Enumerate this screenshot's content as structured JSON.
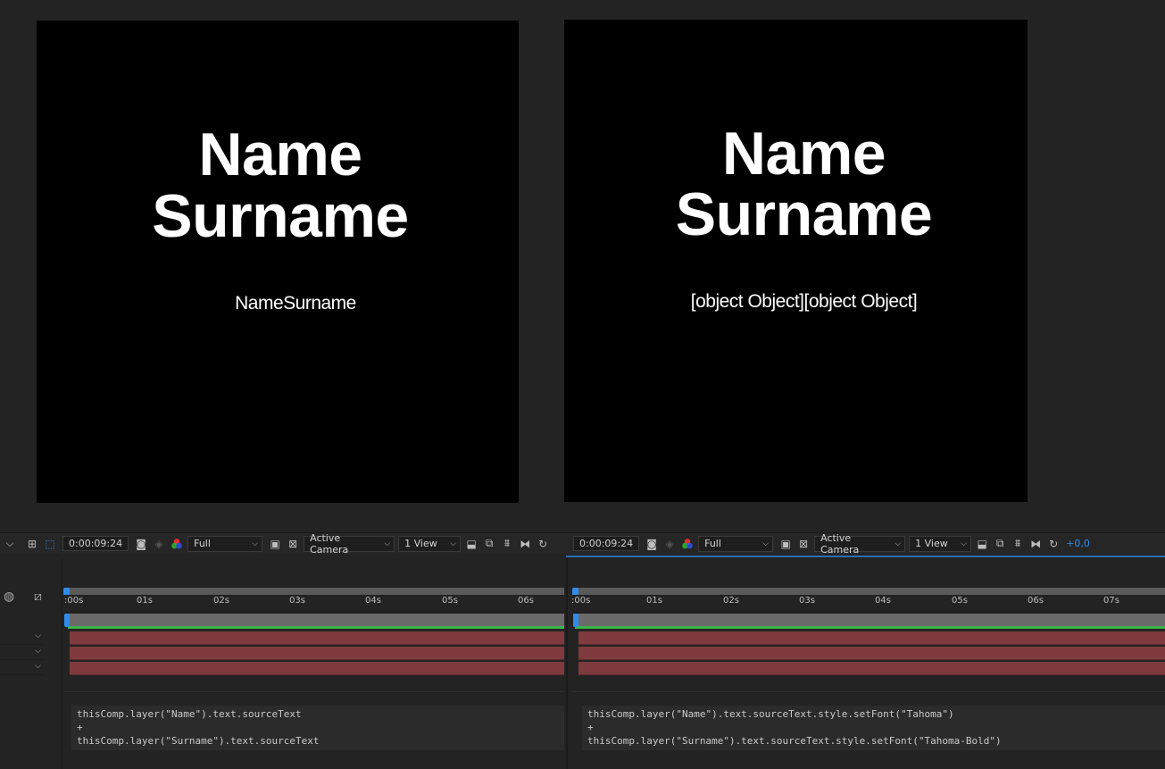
{
  "left_view": {
    "comp_name_line1": "Name",
    "comp_name_line2": "Surname",
    "result_text": "NameSurname",
    "toolbar": {
      "timecode": "0:00:09:24",
      "resolution": "Full",
      "camera": "Active Camera",
      "views": "1 View"
    },
    "ruler_ticks": [
      ":00s",
      "01s",
      "02s",
      "03s",
      "04s",
      "05s",
      "06s"
    ],
    "expression": {
      "line1": "thisComp.layer(\"Name\").text.sourceText",
      "line2": "+",
      "line3": "thisComp.layer(\"Surname\").text.sourceText"
    }
  },
  "right_view": {
    "comp_name_line1": "Name",
    "comp_name_line2": "Surname",
    "result_text": "[object Object][object Object]",
    "toolbar": {
      "timecode": "0:00:09:24",
      "resolution": "Full",
      "camera": "Active Camera",
      "views": "1 View",
      "exposure": "+0,0"
    },
    "ruler_ticks": [
      ":00s",
      "01s",
      "02s",
      "03s",
      "04s",
      "05s",
      "06s",
      "07s"
    ],
    "expression": {
      "line1": "thisComp.layer(\"Name\").text.sourceText.style.setFont(\"Tahoma\")",
      "line2": "+",
      "line3": "thisComp.layer(\"Surname\").text.sourceText.style.setFont(\"Tahoma-Bold\")"
    }
  },
  "icons": [
    "chevron-down-icon",
    "region-of-interest-icon",
    "transparency-grid-icon",
    "snapshot-camera-icon",
    "show-snapshot-icon",
    "color-channels-icon",
    "toggle-mask-icon",
    "grid-overlay-icon",
    "fast-preview-icon",
    "timeline-icon",
    "comp-flowchart-icon",
    "reset-exposure-icon",
    "motion-blur-icon",
    "draft-3d-icon"
  ],
  "colors": {
    "accent_blue": "#2d8ceb",
    "layer_bar": "#7e3a3d",
    "work_area_green": "#3cb44b"
  }
}
